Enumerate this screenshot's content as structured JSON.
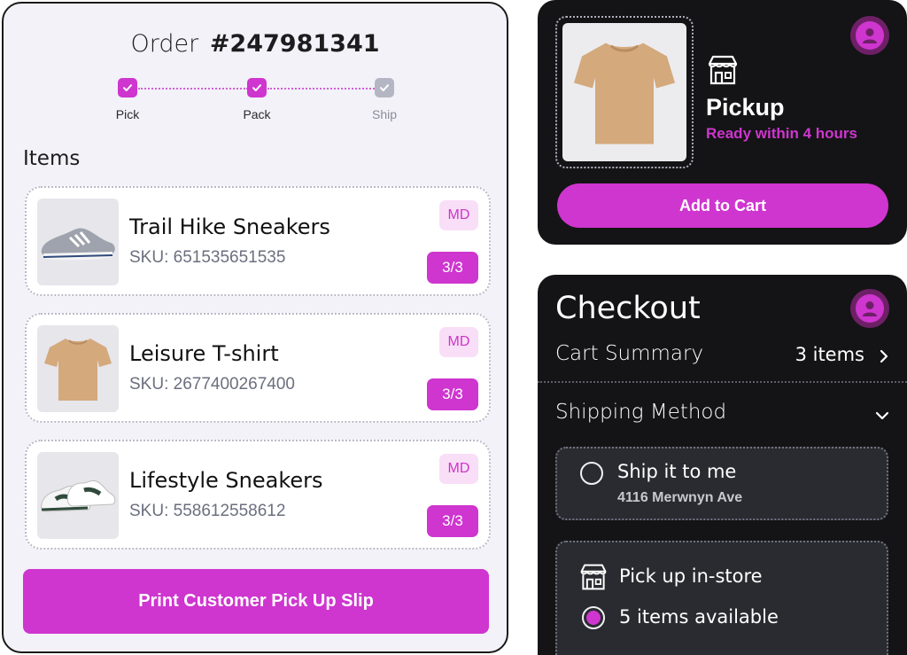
{
  "order": {
    "label": "Order",
    "number": "#247981341",
    "steps": [
      {
        "label": "Pick",
        "done": true
      },
      {
        "label": "Pack",
        "done": true
      },
      {
        "label": "Ship",
        "done": false
      }
    ],
    "items_heading": "Items",
    "items": [
      {
        "name": "Trail Hike Sneakers",
        "sku": "SKU: 651535651535",
        "size": "MD",
        "qty": "3/3",
        "image": "grey-running-sneaker"
      },
      {
        "name": "Leisure T-shirt",
        "sku": "SKU: 2677400267400",
        "size": "MD",
        "qty": "3/3",
        "image": "beige-t-shirt"
      },
      {
        "name": "Lifestyle Sneakers",
        "sku": "SKU: 558612558612",
        "size": "MD",
        "qty": "3/3",
        "image": "white-green-sneakers"
      }
    ],
    "print_button": "Print Customer Pick Up Slip"
  },
  "pickup": {
    "image": "beige-t-shirt",
    "icon": "store-icon",
    "title": "Pickup",
    "subtitle": "Ready within 4 hours",
    "add_button": "Add to Cart",
    "avatar_icon": "user-avatar-icon"
  },
  "checkout": {
    "title": "Checkout",
    "avatar_icon": "user-avatar-icon",
    "cart_summary_label": "Cart Summary",
    "cart_count": "3 items",
    "shipping_method_label": "Shipping Method",
    "options": {
      "ship": {
        "title": "Ship it to me",
        "address": "4116 Merwnyn Ave",
        "selected": false
      },
      "store": {
        "title": "Pick up in-store",
        "availability": "5 items available",
        "selected": true
      }
    }
  },
  "colors": {
    "accent": "#cf35cf",
    "dark_bg": "#141416",
    "light_bg": "#f3f2f8"
  }
}
